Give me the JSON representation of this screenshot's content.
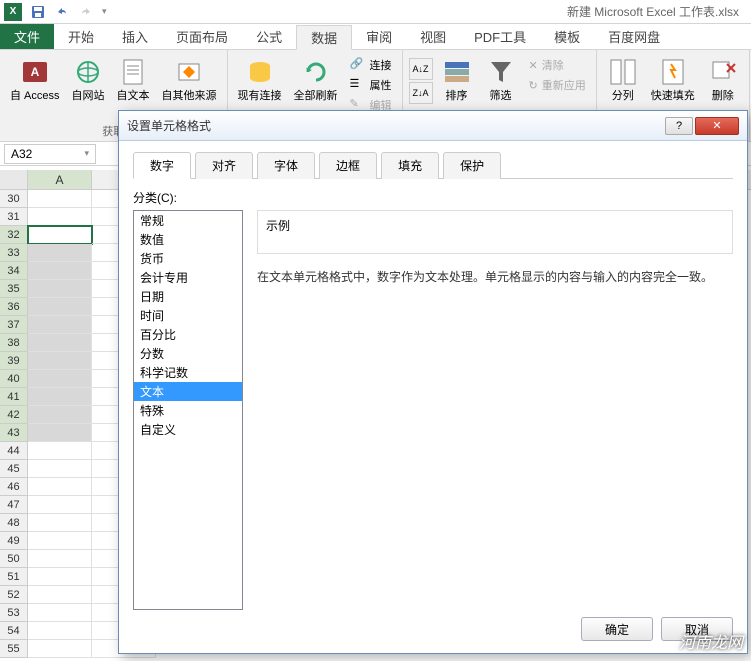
{
  "title_bar": {
    "doc_title": "新建 Microsoft Excel 工作表.xlsx"
  },
  "ribbon_tabs": {
    "file": "文件",
    "items": [
      "开始",
      "插入",
      "页面布局",
      "公式",
      "数据",
      "审阅",
      "视图",
      "PDF工具",
      "模板",
      "百度网盘"
    ],
    "active_index": 4
  },
  "ribbon": {
    "group1_label": "获取",
    "btn_access": "自 Access",
    "btn_web": "自网站",
    "btn_text": "自文本",
    "btn_other": "自其他来源",
    "btn_existing": "现有连接",
    "btn_refresh": "全部刷新",
    "conn_connect": "连接",
    "conn_props": "属性",
    "conn_edit": "编辑",
    "sort_az": "A↓Z",
    "sort_za": "Z↓A",
    "btn_sort": "排序",
    "btn_filter": "筛选",
    "filter_clear": "清除",
    "filter_reapply": "重新应用",
    "btn_split": "分列",
    "btn_flash": "快速填充",
    "btn_remove": "删除"
  },
  "name_box": "A32",
  "grid": {
    "col_a": "A",
    "row_start": 30,
    "row_end": 55,
    "sel_start": 32,
    "sel_end": 43
  },
  "dialog": {
    "title": "设置单元格格式",
    "tabs": [
      "数字",
      "对齐",
      "字体",
      "边框",
      "填充",
      "保护"
    ],
    "active_tab": 0,
    "category_label": "分类(C):",
    "categories": [
      "常规",
      "数值",
      "货币",
      "会计专用",
      "日期",
      "时间",
      "百分比",
      "分数",
      "科学记数",
      "文本",
      "特殊",
      "自定义"
    ],
    "selected_category": 9,
    "sample_label": "示例",
    "description": "在文本单元格格式中，数字作为文本处理。单元格显示的内容与输入的内容完全一致。",
    "ok": "确定",
    "cancel": "取消",
    "help_icon": "?",
    "close_icon": "✕"
  },
  "watermark": "河南龙网"
}
